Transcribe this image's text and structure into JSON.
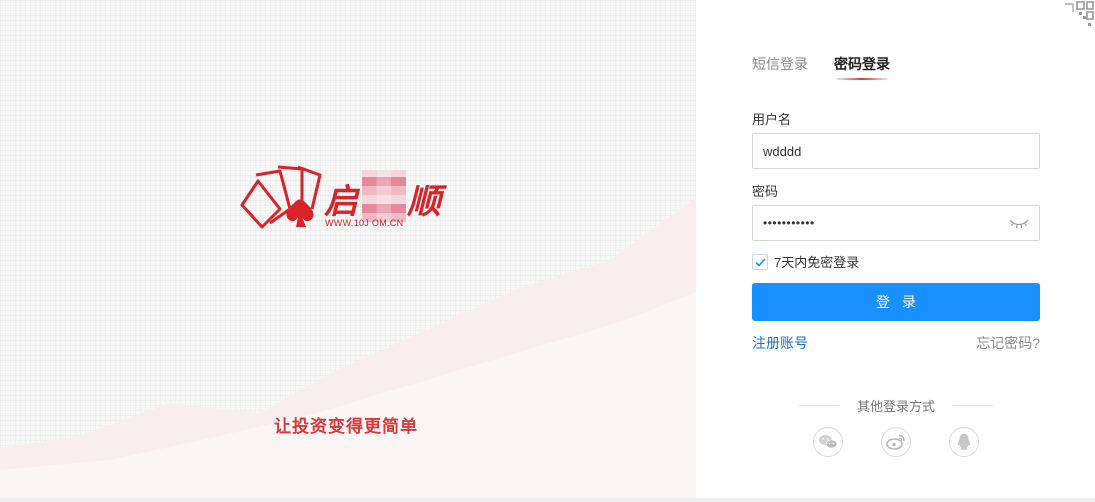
{
  "brand": {
    "logo_text_visible": "启",
    "logo_text_tail": "顺",
    "logo_url": "WWW.10J        OM.CN",
    "slogan": "让投资变得更简单"
  },
  "login": {
    "tabs": [
      {
        "label": "短信登录",
        "active": false
      },
      {
        "label": "密码登录",
        "active": true
      }
    ],
    "username_label": "用户名",
    "username_value": "wdddd",
    "password_label": "密码",
    "password_masked": "•••••••••••",
    "remember_label": "7天内免密登录",
    "remember_checked": true,
    "submit_label": "登录",
    "register_label": "注册账号",
    "forgot_label": "忘记密码?",
    "other_methods_label": "其他登录方式",
    "social_icons": [
      "wechat-icon",
      "weibo-icon",
      "qq-icon"
    ]
  },
  "colors": {
    "brand_red": "#d8232a",
    "primary_blue": "#1890ff",
    "link_blue": "#1a73c9"
  }
}
